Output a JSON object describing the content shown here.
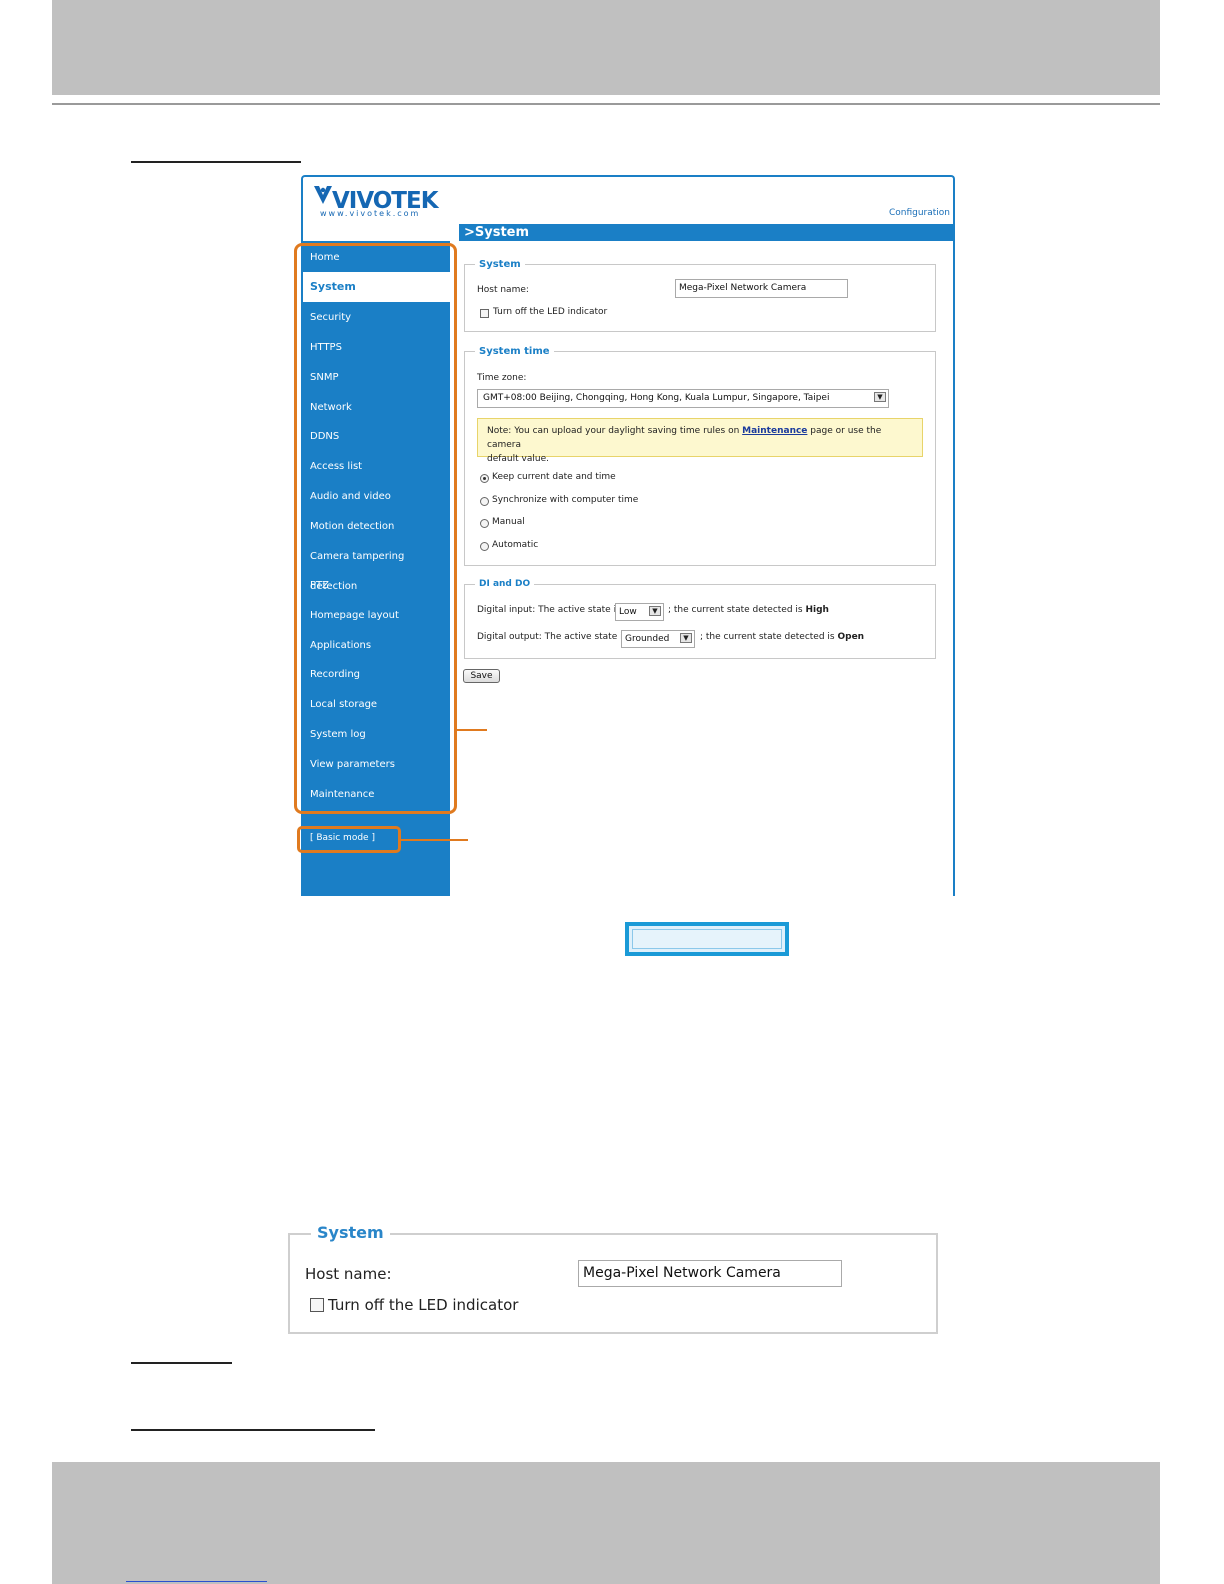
{
  "app": {
    "brand": "VIVOTEK",
    "brand_sub": "www.vivotek.com",
    "config_link": "Configuration",
    "page_title": ">System"
  },
  "sidebar": {
    "items": [
      {
        "label": "Home",
        "active": false
      },
      {
        "label": "System",
        "active": true
      },
      {
        "label": "Security",
        "active": false
      },
      {
        "label": "HTTPS",
        "active": false
      },
      {
        "label": "SNMP",
        "active": false
      },
      {
        "label": "Network",
        "active": false
      },
      {
        "label": "DDNS",
        "active": false
      },
      {
        "label": "Access list",
        "active": false
      },
      {
        "label": "Audio and video",
        "active": false
      },
      {
        "label": "Motion detection",
        "active": false
      },
      {
        "label": "Camera tampering detection",
        "active": false
      },
      {
        "label": "PTZ",
        "active": false
      },
      {
        "label": "Homepage layout",
        "active": false
      },
      {
        "label": "Applications",
        "active": false
      },
      {
        "label": "Recording",
        "active": false
      },
      {
        "label": "Local storage",
        "active": false
      },
      {
        "label": "System log",
        "active": false
      },
      {
        "label": "View parameters",
        "active": false
      },
      {
        "label": "Maintenance",
        "active": false
      }
    ],
    "basic_mode": "[ Basic mode ]"
  },
  "system_section": {
    "legend": "System",
    "host_label": "Host name:",
    "host_value": "Mega-Pixel Network Camera",
    "led_label": "Turn off the LED indicator",
    "led_checked": false
  },
  "time_section": {
    "legend": "System time",
    "tz_label": "Time zone:",
    "tz_value": "GMT+08:00 Beijing, Chongqing, Hong Kong, Kuala Lumpur, Singapore, Taipei",
    "note_prefix": "Note: You can upload your daylight saving time rules on",
    "note_link": "Maintenance",
    "note_suffix": "page or use the camera",
    "note_line2": "default value.",
    "options": [
      {
        "label": "Keep current date and time",
        "selected": true
      },
      {
        "label": "Synchronize with computer time",
        "selected": false
      },
      {
        "label": "Manual",
        "selected": false
      },
      {
        "label": "Automatic",
        "selected": false
      }
    ]
  },
  "dido_section": {
    "legend": "DI and DO",
    "di_prefix": "Digital input: The active state is",
    "di_value": "Low",
    "di_mid": "; the current state detected is",
    "di_state": "High",
    "do_prefix": "Digital output: The active state is",
    "do_value": "Grounded",
    "do_mid": "; the current state detected is",
    "do_state": "Open"
  },
  "save_label": "Save",
  "zoom_panel": {
    "legend": "System",
    "host_label": "Host name:",
    "host_value": "Mega-Pixel Network Camera",
    "led_label": "Turn off the LED indicator"
  },
  "colors": {
    "accent": "#1a7fc6",
    "highlight": "#e07a1f",
    "callout": "#1a9ad7"
  }
}
